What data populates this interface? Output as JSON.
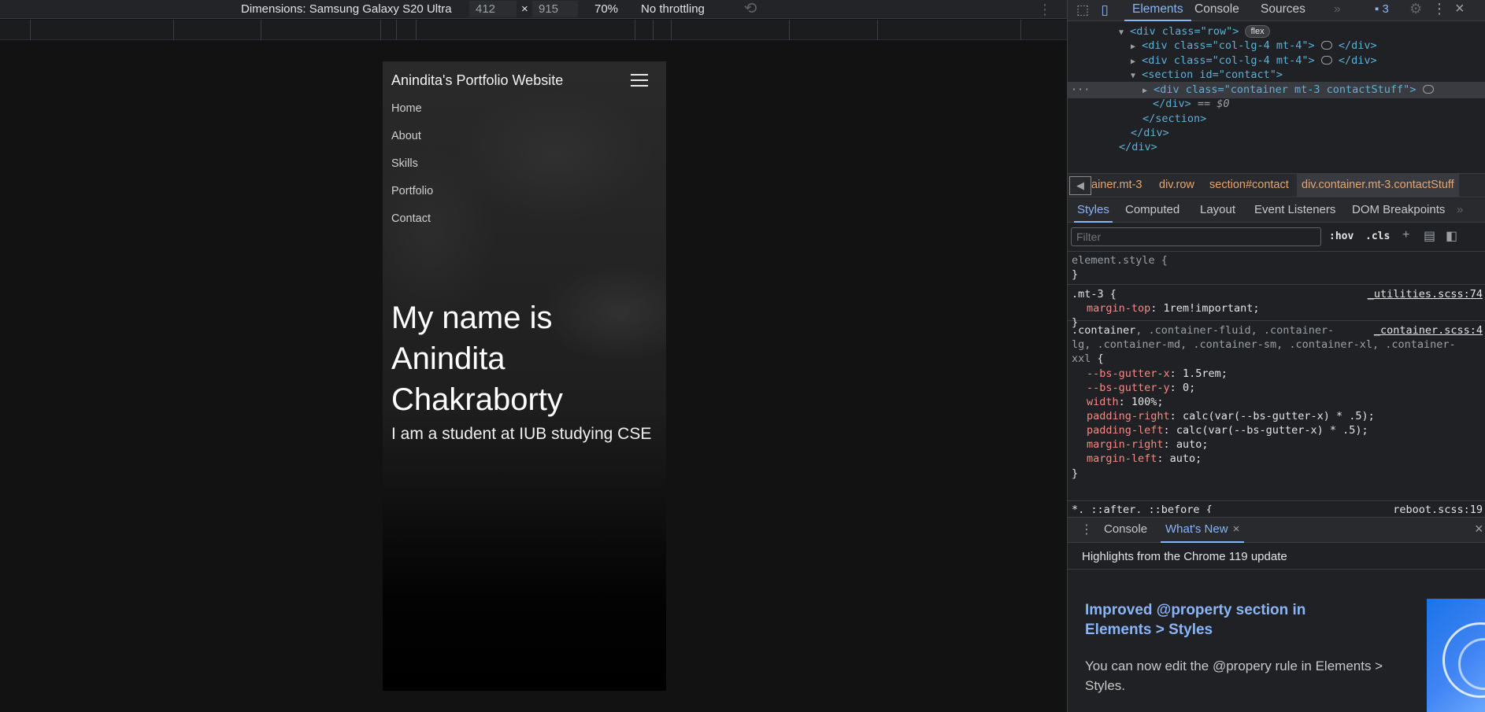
{
  "device_toolbar": {
    "dimensions_label": "Dimensions: Samsung Galaxy S20 Ultra",
    "width": "412",
    "times": "×",
    "height": "915",
    "zoom": "70%",
    "throttling": "No throttling"
  },
  "phone": {
    "brand": "Anindita's Portfolio Website",
    "nav": [
      "Home",
      "About",
      "Skills",
      "Portfolio",
      "Contact"
    ],
    "hero_title": "My name is Anindita Chakraborty",
    "hero_subtitle": "I am a student at IUB studying CSE"
  },
  "devtools": {
    "tabs": [
      "Elements",
      "Console",
      "Sources"
    ],
    "more_tabs": "»",
    "issues_count": "3",
    "dom": {
      "row_div": "<div class=\"row\">",
      "flex_badge": "flex",
      "col1_open": "<div class=\"col-lg-4 mt-4\">",
      "col1_close": "</div>",
      "col2_open": "<div class=\"col-lg-4 mt-4\">",
      "col2_close": "</div>",
      "section_open": "<section id=\"contact\">",
      "container_open": "<div class=\"container mt-3 contactStuff\">",
      "div_close": "</div>",
      "eq0": "== $0",
      "section_close": "</section>",
      "div_close2": "</div>",
      "div_close3": "</div>",
      "gutter_dots": "···"
    },
    "breadcrumb": [
      "ainer.mt-3",
      "div.row",
      "section#contact",
      "div.container.mt-3.contactStuff"
    ],
    "styles_tabs": [
      "Styles",
      "Computed",
      "Layout",
      "Event Listeners",
      "DOM Breakpoints"
    ],
    "filter_placeholder": "Filter",
    "hov": ":hov",
    "cls": ".cls",
    "rules": {
      "element_style": "element.style {",
      "close": "}",
      "mt3_selector": ".mt-3 {",
      "mt3_source": "_utilities.scss:74",
      "mt3_prop": "margin-top",
      "mt3_val": "1rem!important;",
      "container_selector_main": ".container",
      "container_selector_rest1": ", .container-fluid, .container-",
      "container_selector_rest2": "lg, .container-md, .container-sm, .container-xl, .container-",
      "container_selector_rest3": "xxl",
      "container_source": "_container.scss:4",
      "props": [
        {
          "name": "--bs-gutter-x",
          "value": "1.5rem;"
        },
        {
          "name": "--bs-gutter-y",
          "value": "0;"
        },
        {
          "name": "width",
          "value": "100%;"
        },
        {
          "name": "padding-right",
          "value": "calc(var(--bs-gutter-x) * .5);"
        },
        {
          "name": "padding-left",
          "value": "calc(var(--bs-gutter-x) * .5);"
        },
        {
          "name": "margin-right",
          "value": "auto;"
        },
        {
          "name": "margin-left",
          "value": "auto;"
        }
      ],
      "star_selector": "*, ::after, ::before {",
      "star_source": "_reboot.scss:19"
    },
    "drawer": {
      "tabs": [
        "Console",
        "What's New"
      ],
      "tab_close": "×",
      "header": "Highlights from the Chrome 119 update",
      "feature_title": "Improved @property section in Elements > Styles",
      "feature_desc": "You can now edit the @propery rule in Elements > Styles."
    }
  },
  "colors": {
    "accent": "#8ab4f8",
    "breadcrumb": "#e3a572",
    "css_property": "#f28b82"
  }
}
